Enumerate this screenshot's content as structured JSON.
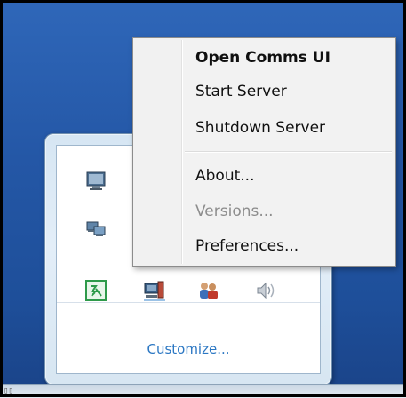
{
  "menu": {
    "items": [
      {
        "label": "Open Comms UI",
        "bold": true,
        "enabled": true
      },
      {
        "label": "Start Server",
        "bold": false,
        "enabled": true
      },
      {
        "label": "Shutdown Server",
        "bold": false,
        "enabled": true
      },
      {
        "label": "About...",
        "bold": false,
        "enabled": true
      },
      {
        "label": "Versions...",
        "bold": false,
        "enabled": false
      },
      {
        "label": "Preferences...",
        "bold": false,
        "enabled": true
      }
    ]
  },
  "flyout": {
    "customize_label": "Customize...",
    "icons": [
      {
        "name": "monitor-icon"
      },
      {
        "name": "network-computers-icon"
      },
      {
        "name": "green-app-icon"
      },
      {
        "name": "server-computer-icon"
      },
      {
        "name": "users-icon"
      },
      {
        "name": "speaker-icon"
      }
    ]
  },
  "colors": {
    "desktop": "#2457a6",
    "link": "#2b77c3",
    "disabled_text": "#8d8d8d"
  }
}
